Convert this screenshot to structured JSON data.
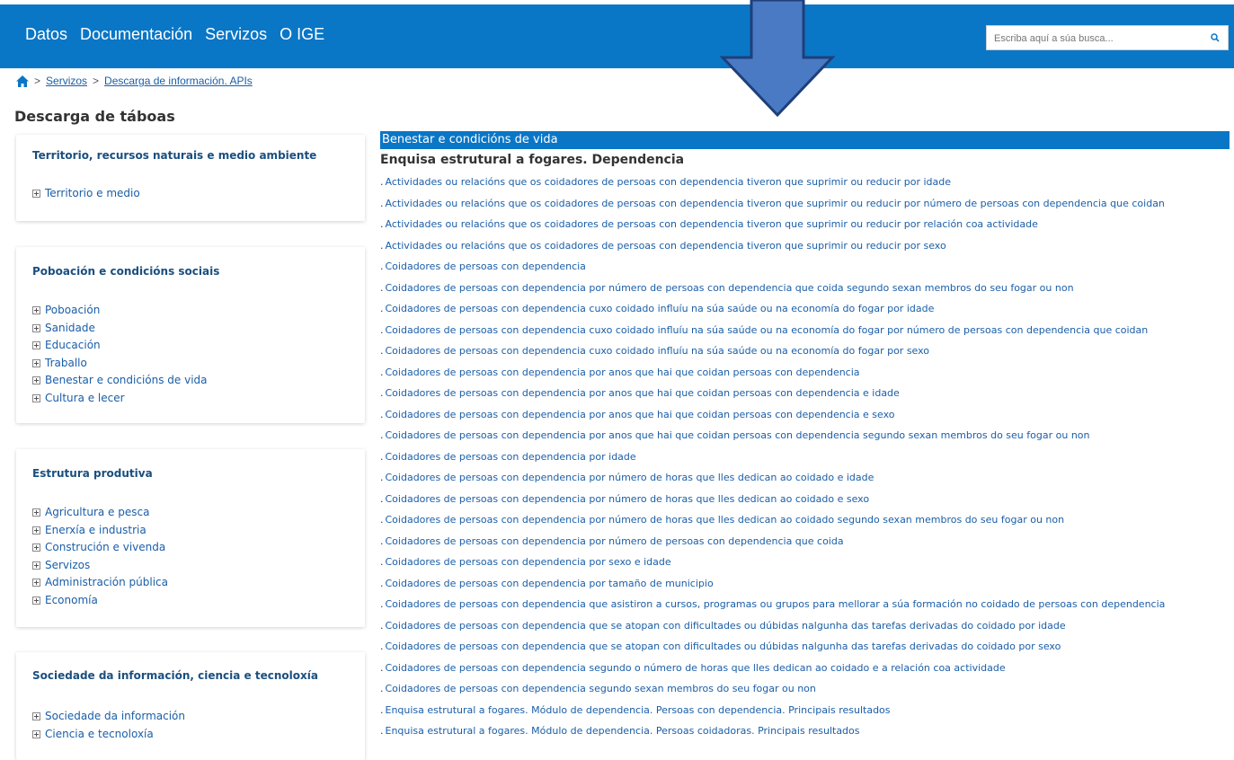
{
  "nav": {
    "items": [
      "Datos",
      "Documentación",
      "Servizos",
      "O IGE"
    ],
    "search_placeholder": "Escriba aquí a súa busca..."
  },
  "breadcrumb": {
    "sep": ">",
    "items": [
      "Servizos",
      "Descarga de información. APIs"
    ]
  },
  "page_title": "Descarga de táboas",
  "sidebar": [
    {
      "title": "Territorio, recursos naturais e medio ambiente",
      "items": [
        "Territorio e medio"
      ]
    },
    {
      "title": "Poboación e condicións sociais",
      "items": [
        "Poboación",
        "Sanidade",
        "Educación",
        "Traballo",
        "Benestar e condicións de vida",
        "Cultura e lecer"
      ]
    },
    {
      "title": "Estrutura produtiva",
      "items": [
        "Agricultura e pesca",
        "Enerxía e industria",
        "Construción e vivenda",
        "Servizos",
        "Administración pública",
        "Economía"
      ]
    },
    {
      "title": "Sociedade da información, ciencia e tecnoloxía",
      "items": [
        "Sociedade da información",
        "Ciencia e tecnoloxía"
      ]
    }
  ],
  "main": {
    "category": "Benestar e condicións de vida",
    "subtitle": "Enquisa estrutural a fogares. Dependencia",
    "links": [
      "Actividades ou relacións que os coidadores de persoas con dependencia tiveron que suprimir ou reducir por idade",
      "Actividades ou relacións que os coidadores de persoas con dependencia tiveron que suprimir ou reducir por número de persoas con dependencia que coidan",
      "Actividades ou relacións que os coidadores de persoas con dependencia tiveron que suprimir ou reducir por relación coa actividade",
      "Actividades ou relacións que os coidadores de persoas con dependencia tiveron que suprimir ou reducir por sexo",
      "Coidadores de persoas con dependencia",
      "Coidadores de persoas con dependencia por número de persoas con dependencia que coida segundo sexan membros do seu fogar ou non",
      "Coidadores de persoas con dependencia cuxo coidado influíu na súa saúde ou na economía do fogar por idade",
      "Coidadores de persoas con dependencia cuxo coidado influíu na súa saúde ou na economía do fogar por número de persoas con dependencia que coidan",
      "Coidadores de persoas con dependencia cuxo coidado influíu na súa saúde ou na economía do fogar por sexo",
      "Coidadores de persoas con dependencia por anos que hai que coidan persoas con dependencia",
      "Coidadores de persoas con dependencia por anos que hai que coidan persoas con dependencia e idade",
      "Coidadores de persoas con dependencia por anos que hai que coidan persoas con dependencia e sexo",
      "Coidadores de persoas con dependencia por anos que hai que coidan persoas con dependencia segundo sexan membros do seu fogar ou non",
      "Coidadores de persoas con dependencia por idade",
      "Coidadores de persoas con dependencia por número de horas que lles dedican ao coidado e idade",
      "Coidadores de persoas con dependencia por número de horas que lles dedican ao coidado e sexo",
      "Coidadores de persoas con dependencia por número de horas que lles dedican ao coidado segundo sexan membros do seu fogar ou non",
      "Coidadores de persoas con dependencia por número de persoas con dependencia que coida",
      "Coidadores de persoas con dependencia por sexo e idade",
      "Coidadores de persoas con dependencia por tamaño de municipio",
      "Coidadores de persoas con dependencia que asistiron a cursos, programas ou grupos para mellorar a súa formación no coidado de persoas con dependencia",
      "Coidadores de persoas con dependencia que se atopan con dificultades ou dúbidas nalgunha das tarefas derivadas do coidado por idade",
      "Coidadores de persoas con dependencia que se atopan con dificultades ou dúbidas nalgunha das tarefas derivadas do coidado por sexo",
      "Coidadores de persoas con dependencia segundo o número de horas que lles dedican ao coidado e a relación coa actividade",
      "Coidadores de persoas con dependencia segundo sexan membros do seu fogar ou non",
      "Enquisa estrutural a fogares. Módulo de dependencia. Persoas con dependencia. Principais resultados",
      "Enquisa estrutural a fogares. Módulo de dependencia. Persoas coidadoras. Principais resultados"
    ]
  },
  "colors": {
    "brand_blue": "#0a76c6",
    "link_blue": "#1a5ea8",
    "arrow_fill": "#4a7ac4",
    "arrow_stroke": "#1f3f7a"
  }
}
